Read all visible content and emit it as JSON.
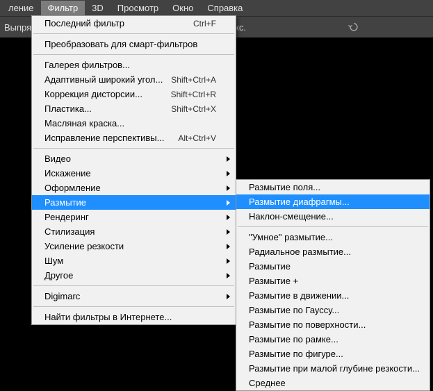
{
  "menubar": {
    "items": [
      "ление",
      "Фильтр",
      "3D",
      "Просмотр",
      "Окно",
      "Справка"
    ],
    "active_index": 1
  },
  "toolbar": {
    "left_label": "Выпрями",
    "text": "кс."
  },
  "menu1": {
    "groups": [
      [
        {
          "label": "Последний фильтр",
          "accel": "Ctrl+F"
        }
      ],
      [
        {
          "label": "Преобразовать для смарт-фильтров"
        }
      ],
      [
        {
          "label": "Галерея фильтров..."
        },
        {
          "label": "Адаптивный широкий угол...",
          "accel": "Shift+Ctrl+A"
        },
        {
          "label": "Коррекция дисторсии...",
          "accel": "Shift+Ctrl+R"
        },
        {
          "label": "Пластика...",
          "accel": "Shift+Ctrl+X"
        },
        {
          "label": "Масляная краска..."
        },
        {
          "label": "Исправление перспективы...",
          "accel": "Alt+Ctrl+V"
        }
      ],
      [
        {
          "label": "Видео",
          "sub": true
        },
        {
          "label": "Искажение",
          "sub": true
        },
        {
          "label": "Оформление",
          "sub": true
        },
        {
          "label": "Размытие",
          "sub": true,
          "hover": true
        },
        {
          "label": "Рендеринг",
          "sub": true
        },
        {
          "label": "Стилизация",
          "sub": true
        },
        {
          "label": "Усиление резкости",
          "sub": true
        },
        {
          "label": "Шум",
          "sub": true
        },
        {
          "label": "Другое",
          "sub": true
        }
      ],
      [
        {
          "label": "Digimarc",
          "sub": true
        }
      ],
      [
        {
          "label": "Найти фильтры в Интернете..."
        }
      ]
    ]
  },
  "menu2": {
    "groups": [
      [
        {
          "label": "Размытие поля..."
        },
        {
          "label": "Размытие диафрагмы...",
          "hover": true
        },
        {
          "label": "Наклон-смещение..."
        }
      ],
      [
        {
          "label": "\"Умное\" размытие..."
        },
        {
          "label": "Радиальное размытие..."
        },
        {
          "label": "Размытие"
        },
        {
          "label": "Размытие +"
        },
        {
          "label": "Размытие в движении..."
        },
        {
          "label": "Размытие по Гауссу..."
        },
        {
          "label": "Размытие по поверхности..."
        },
        {
          "label": "Размытие по рамке..."
        },
        {
          "label": "Размытие по фигуре..."
        },
        {
          "label": "Размытие при малой глубине резкости..."
        },
        {
          "label": "Среднее"
        }
      ]
    ]
  }
}
